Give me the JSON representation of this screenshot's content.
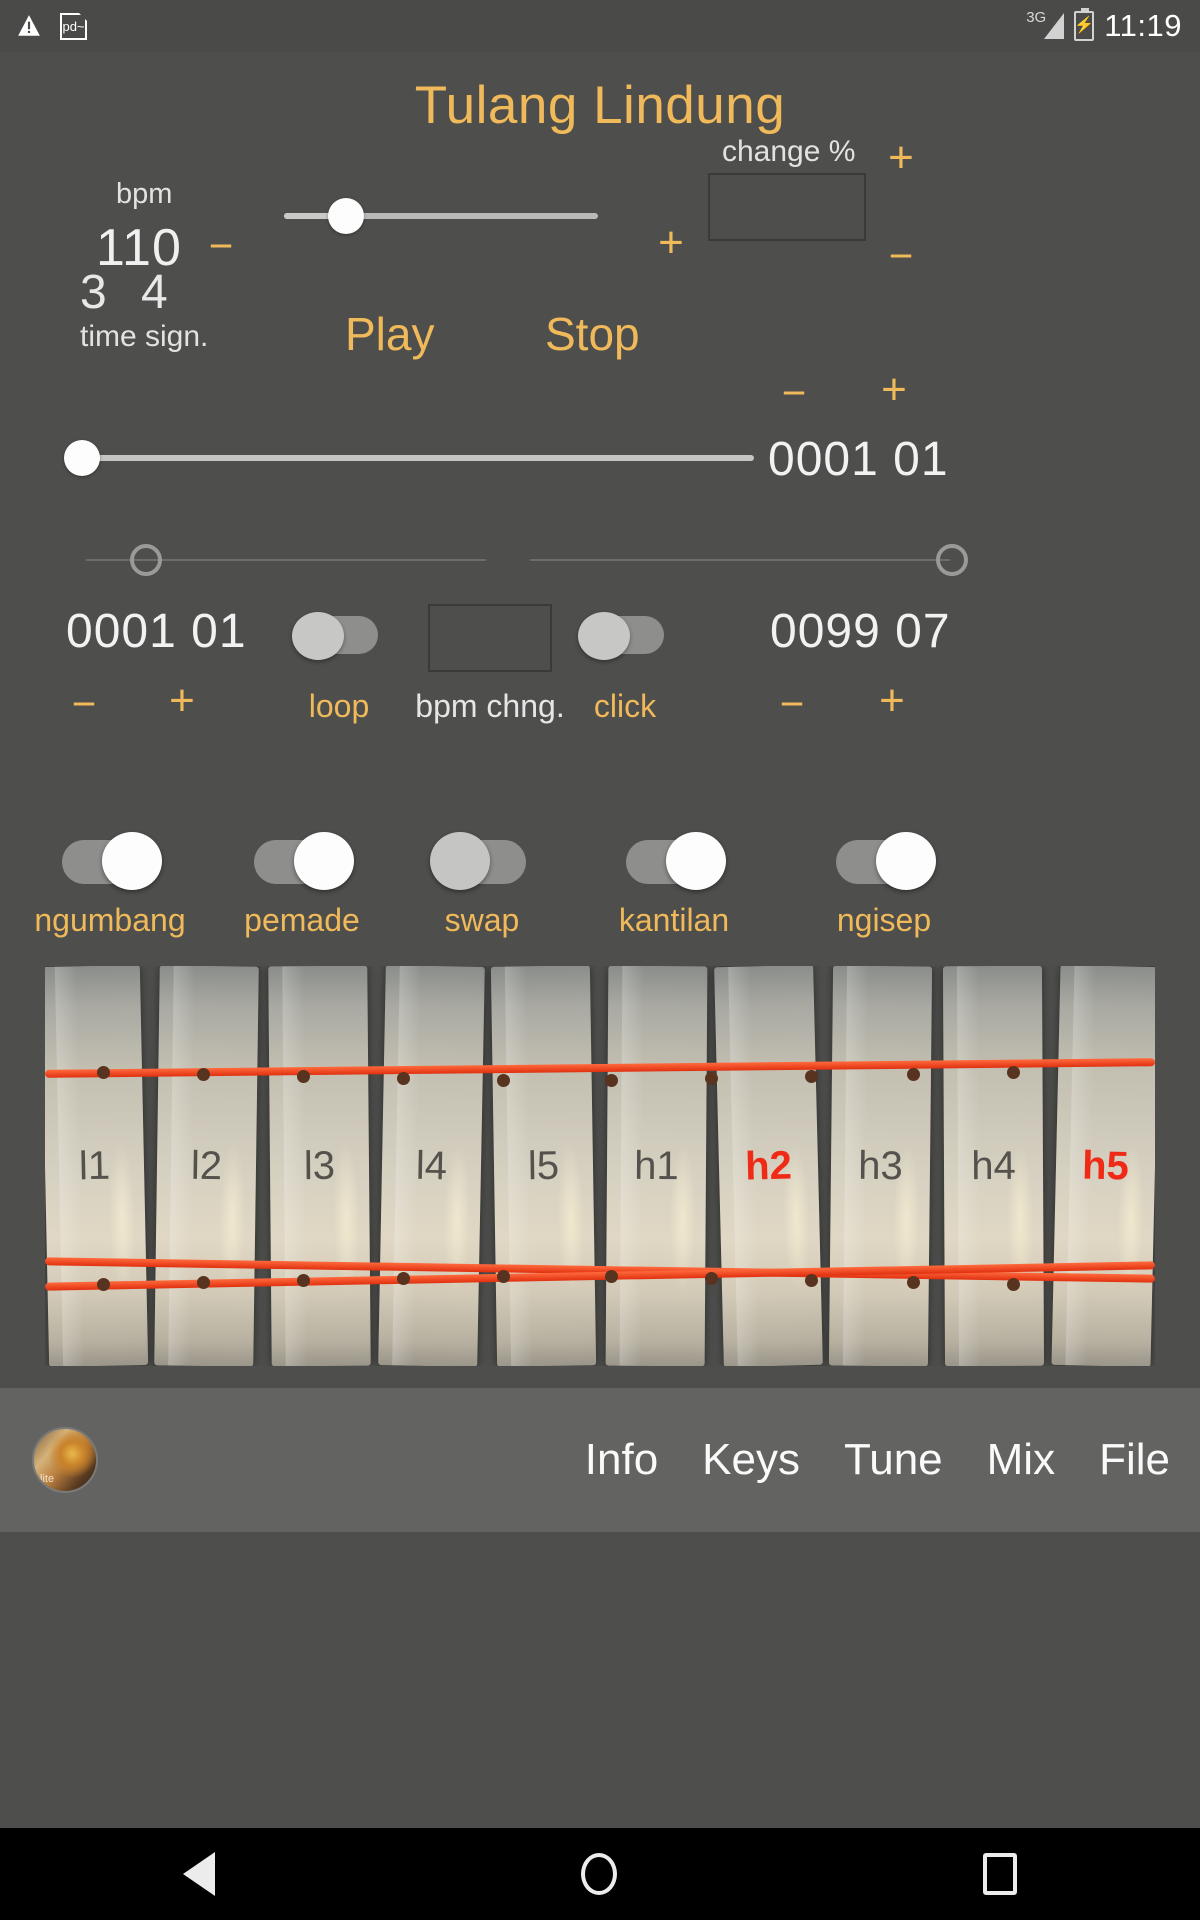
{
  "status_bar": {
    "warning_icon": "warning-triangle-icon",
    "pd_icon_label": "pd~",
    "network": "3G",
    "battery_icon": "battery-charging-icon",
    "time": "11:19"
  },
  "header": {
    "title": "Tulang Lindung"
  },
  "tempo": {
    "bpm_label": "bpm",
    "bpm_value": "110",
    "minus": "−",
    "plus": "+",
    "slider_percent": 20
  },
  "change": {
    "label": "change %",
    "value": "",
    "plus": "+",
    "minus": "−"
  },
  "time_signature": {
    "beats": "3",
    "unit": "4",
    "label": "time sign."
  },
  "transport": {
    "play": "Play",
    "stop": "Stop"
  },
  "position": {
    "minus": "−",
    "plus": "+",
    "value": "0001 01",
    "slider_percent": 0
  },
  "loop_region": {
    "start_value": "0001 01",
    "end_value": "0099 07",
    "start_minus": "−",
    "start_plus": "+",
    "end_minus": "−",
    "end_plus": "+",
    "loop_toggle": {
      "label": "loop",
      "state": "off"
    },
    "bpm_change": {
      "label": "bpm chng.",
      "value": ""
    },
    "click_toggle": {
      "label": "click",
      "state": "off"
    }
  },
  "parts": [
    {
      "label": "ngumbang",
      "state": "on"
    },
    {
      "label": "pemade",
      "state": "on"
    },
    {
      "label": "swap",
      "state": "off"
    },
    {
      "label": "kantilan",
      "state": "on"
    },
    {
      "label": "ngisep",
      "state": "on"
    }
  ],
  "instrument": {
    "keys": [
      {
        "label": "l1",
        "highlighted": false
      },
      {
        "label": "l2",
        "highlighted": false
      },
      {
        "label": "l3",
        "highlighted": false
      },
      {
        "label": "l4",
        "highlighted": false
      },
      {
        "label": "l5",
        "highlighted": false
      },
      {
        "label": "h1",
        "highlighted": false
      },
      {
        "label": "h2",
        "highlighted": true
      },
      {
        "label": "h3",
        "highlighted": false
      },
      {
        "label": "h4",
        "highlighted": false
      },
      {
        "label": "h5",
        "highlighted": true
      }
    ],
    "highlight_color": "#ef2b17"
  },
  "bottom_nav": {
    "logo_caption": "lite",
    "items": [
      "Info",
      "Keys",
      "Tune",
      "Mix",
      "File"
    ]
  },
  "android_nav": {
    "back": "back-triangle-icon",
    "home": "home-circle-icon",
    "recents": "recents-square-icon"
  },
  "colors": {
    "accent": "#f0b95a",
    "background": "#4e4e4c",
    "text": "#f0f0f0",
    "highlight": "#ef2b17"
  }
}
